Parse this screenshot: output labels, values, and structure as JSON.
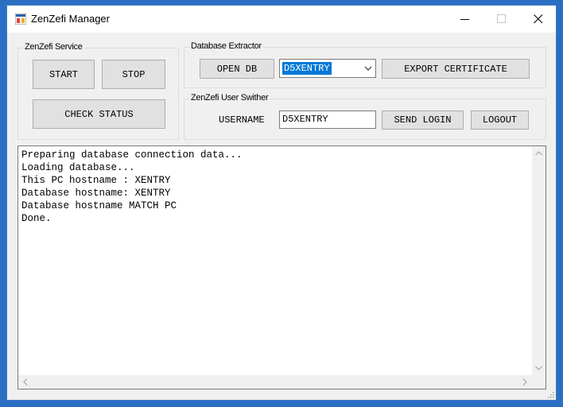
{
  "window": {
    "title": "ZenZefi Manager"
  },
  "service": {
    "label": "ZenZefi Service",
    "start": "START",
    "stop": "STOP",
    "check_status": "CHECK STATUS"
  },
  "extractor": {
    "label": "Database Extractor",
    "open_db": "OPEN DB",
    "selected": "D5XENTRY",
    "export": "EXPORT CERTIFICATE"
  },
  "switcher": {
    "label": "ZenZefi User Swither",
    "username_label": "USERNAME",
    "username_value": "D5XENTRY",
    "send_login": "SEND LOGIN",
    "logout": "LOGOUT"
  },
  "log": {
    "lines": [
      "Preparing database connection data...",
      "Loading database...",
      "This PC hostname : XENTRY",
      "Database hostname: XENTRY",
      "Database hostname MATCH PC",
      "Done."
    ]
  },
  "colors": {
    "accent": "#0078d7",
    "desktop": "#2b6fc2"
  }
}
